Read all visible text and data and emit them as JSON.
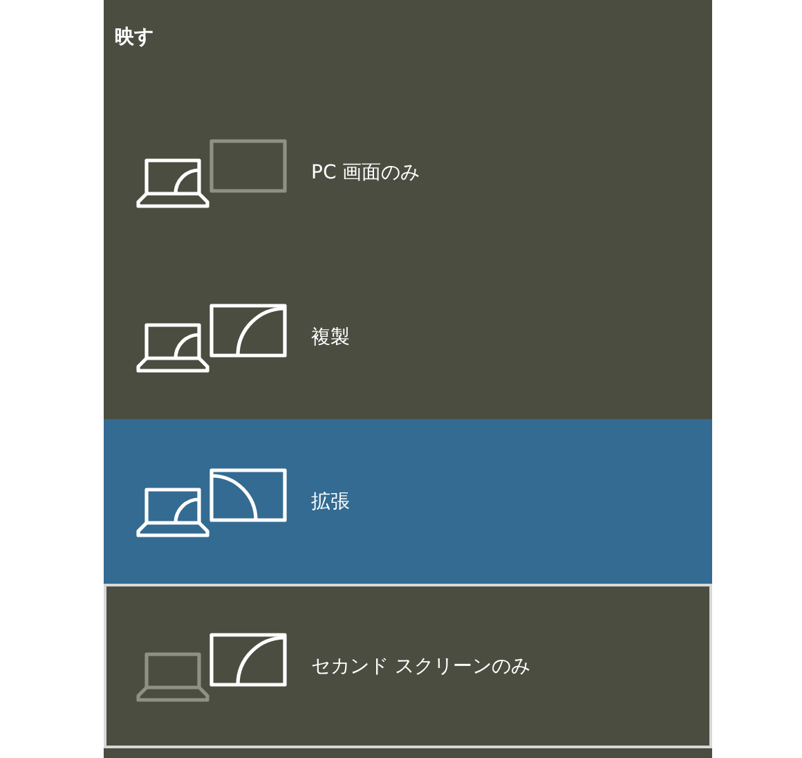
{
  "title": "映す",
  "modes": [
    {
      "kind": "pc_only",
      "label": "PC 画面のみ",
      "selected": false,
      "focused": false
    },
    {
      "kind": "duplicate",
      "label": "複製",
      "selected": false,
      "focused": false
    },
    {
      "kind": "extend",
      "label": "拡張",
      "selected": true,
      "focused": false
    },
    {
      "kind": "second_only",
      "label": "セカンド スクリーンのみ",
      "selected": false,
      "focused": true
    }
  ]
}
